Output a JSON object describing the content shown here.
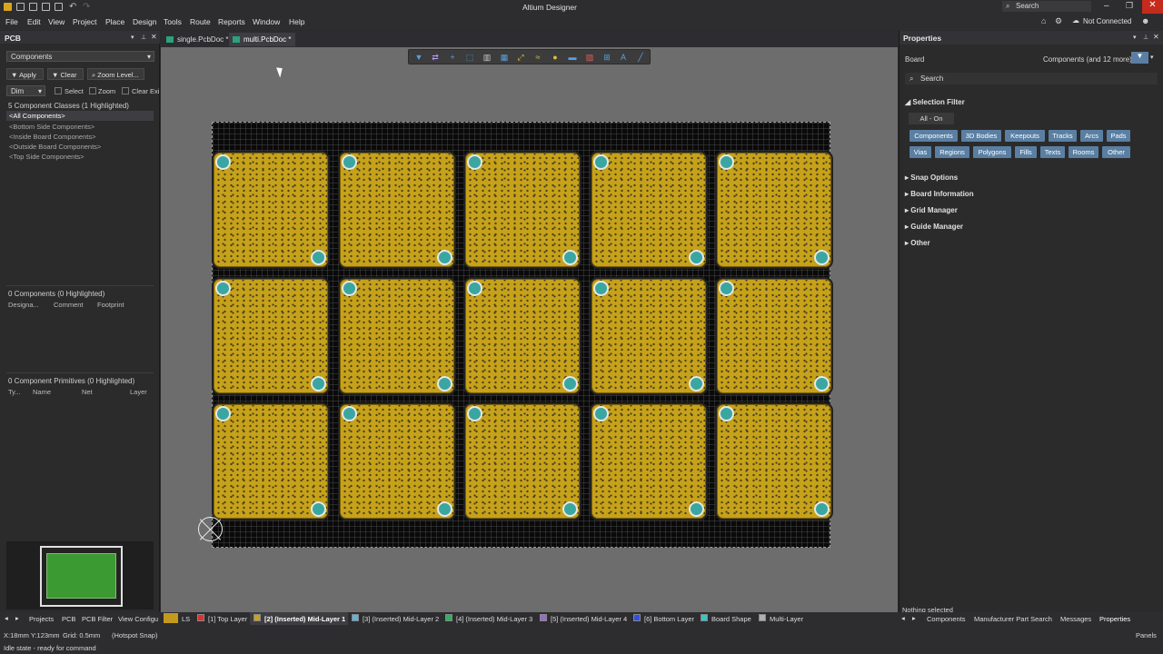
{
  "window": {
    "title": "Altium Designer",
    "search_placeholder": "Search",
    "not_connected": "Not Connected"
  },
  "menu": [
    "File",
    "Edit",
    "View",
    "Project",
    "Place",
    "Design",
    "Tools",
    "Route",
    "Reports",
    "Window",
    "Help"
  ],
  "left_panel": {
    "title": "PCB",
    "mode_select": "Components",
    "apply": "Apply",
    "clear": "Clear",
    "zoom_level": "Zoom Level...",
    "dim_select": "Dim",
    "select_label": "Select",
    "zoom_label": "Zoom",
    "clear_existing": "Clear Exis",
    "classes_header": "5 Component Classes (1 Highlighted)",
    "classes": [
      "<All Components>",
      "<Bottom Side Components>",
      "<Inside Board Components>",
      "<Outside Board Components>",
      "<Top Side Components>"
    ],
    "components_header": "0 Components (0 Highlighted)",
    "component_cols": [
      "Designa...",
      "Comment",
      "Footprint"
    ],
    "primitives_header": "0 Component Primitives (0 Highlighted)",
    "primitive_cols": [
      "Ty...",
      "Name",
      "Net",
      "Layer"
    ]
  },
  "doc_tabs": [
    "single.PcbDoc *",
    "multi.PcbDoc *"
  ],
  "board": {
    "rows": 3,
    "cols": 5
  },
  "right_panel": {
    "title": "Properties",
    "object": "Board",
    "scope": "Components (and 12 more)",
    "search_placeholder": "Search",
    "selection_filter": "Selection Filter",
    "all_on": "All - On",
    "filters_row1": [
      "Components",
      "3D Bodies",
      "Keepouts",
      "Tracks",
      "Arcs",
      "Pads"
    ],
    "filters_row2": [
      "Vias",
      "Regions",
      "Polygons",
      "Fills",
      "Texts",
      "Rooms",
      "Other"
    ],
    "sections": [
      "Snap Options",
      "Board Information",
      "Grid Manager",
      "Guide Manager",
      "Other"
    ],
    "nothing_selected": "Nothing selected"
  },
  "bottom_left_tabs": [
    "Projects",
    "PCB",
    "PCB Filter",
    "View Configu"
  ],
  "layers": [
    {
      "name": "LS",
      "color": "#c49a1c"
    },
    {
      "name": "[1] Top Layer",
      "color": "#e03030"
    },
    {
      "name": "[2] (Inserted) Mid-Layer 1",
      "color": "#c8a21c"
    },
    {
      "name": "[3] (Inserted) Mid-Layer 2",
      "color": "#5ab4e0"
    },
    {
      "name": "[4] (Inserted) Mid-Layer 3",
      "color": "#30b060"
    },
    {
      "name": "[5] (Inserted) Mid-Layer 4",
      "color": "#9a6ad0"
    },
    {
      "name": "[6] Bottom Layer",
      "color": "#3050e0"
    },
    {
      "name": "Board Shape",
      "color": "#30c8c8"
    },
    {
      "name": "Multi-Layer",
      "color": "#b0b0b0"
    }
  ],
  "right_bottom_tabs": [
    "Components",
    "Manufacturer Part Search",
    "Messages",
    "Properties"
  ],
  "status": {
    "coords": "X:18mm Y:123mm",
    "grid": "Grid: 0.5mm",
    "snap": "(Hotspot Snap)",
    "state": "Idle state - ready for command",
    "panels": "Panels"
  }
}
